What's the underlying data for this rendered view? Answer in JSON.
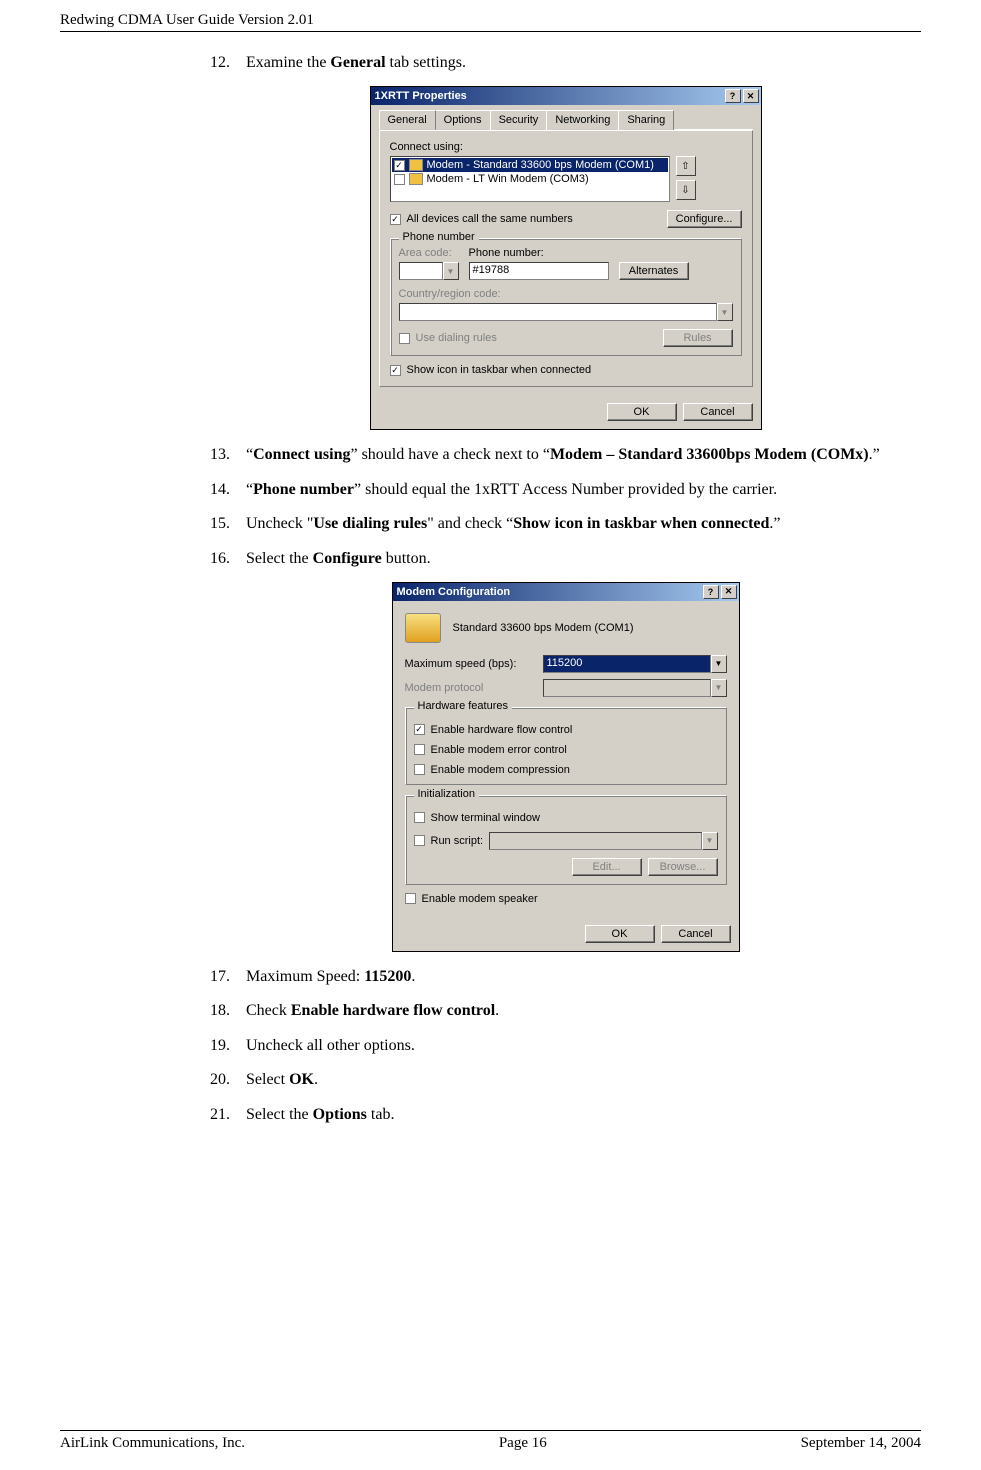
{
  "header": {
    "title": "Redwing CDMA User Guide Version 2.01"
  },
  "steps": {
    "s12": {
      "num": "12.",
      "pre": "Examine the ",
      "boldA": "General",
      "post": " tab settings."
    },
    "s13": {
      "num": "13.",
      "p1": "“",
      "b1": "Connect using",
      "p2": "” should have a check next to “",
      "b2": "Modem – Standard 33600bps Modem (COMx)",
      "p3": ".”"
    },
    "s14": {
      "num": "14.",
      "p1": "“",
      "b1": "Phone number",
      "p2": "” should equal the 1xRTT Access Number provided by the carrier."
    },
    "s15": {
      "num": "15.",
      "p1": "Uncheck \"",
      "b1": "Use dialing rules",
      "p2": "\" and check “",
      "b2": "Show icon in taskbar when connected",
      "p3": ".”"
    },
    "s16": {
      "num": "16.",
      "p1": "Select the ",
      "b1": "Configure",
      "p2": " button."
    },
    "s17": {
      "num": "17.",
      "p1": "Maximum Speed: ",
      "b1": "115200",
      "p2": "."
    },
    "s18": {
      "num": "18.",
      "p1": "Check ",
      "b1": "Enable hardware flow control",
      "p2": "."
    },
    "s19": {
      "num": "19.",
      "text": "Uncheck all other options."
    },
    "s20": {
      "num": "20.",
      "p1": "Select ",
      "b1": "OK",
      "p2": "."
    },
    "s21": {
      "num": "21.",
      "p1": "Select the ",
      "b1": "Options",
      "p2": " tab."
    }
  },
  "dialog1": {
    "title": "1XRTT Properties",
    "tabs": [
      "General",
      "Options",
      "Security",
      "Networking",
      "Sharing"
    ],
    "connect_using_label": "Connect using:",
    "modems": [
      {
        "checked": true,
        "label": "Modem - Standard 33600 bps Modem (COM1)",
        "selected": true
      },
      {
        "checked": false,
        "label": "Modem - LT Win Modem (COM3)",
        "selected": false
      }
    ],
    "all_devices": "All devices call the same numbers",
    "configure_btn": "Configure...",
    "phone_group": "Phone number",
    "area_code_label": "Area code:",
    "phone_number_label": "Phone number:",
    "phone_number_value": "#19788",
    "alternates_btn": "Alternates",
    "country_label": "Country/region code:",
    "use_dialing": "Use dialing rules",
    "rules_btn": "Rules",
    "show_icon": "Show icon in taskbar when connected",
    "ok": "OK",
    "cancel": "Cancel"
  },
  "dialog2": {
    "title": "Modem Configuration",
    "modem_name": "Standard 33600 bps Modem (COM1)",
    "max_speed_label": "Maximum speed (bps):",
    "max_speed_value": "115200",
    "modem_protocol_label": "Modem protocol",
    "hw_group": "Hardware features",
    "hw_flow": "Enable hardware flow control",
    "hw_error": "Enable modem error control",
    "hw_comp": "Enable modem compression",
    "init_group": "Initialization",
    "show_term": "Show terminal window",
    "run_script": "Run script:",
    "edit_btn": "Edit...",
    "browse_btn": "Browse...",
    "speaker": "Enable modem speaker",
    "ok": "OK",
    "cancel": "Cancel"
  },
  "footer": {
    "left": "AirLink Communications, Inc.",
    "center": "Page 16",
    "right": "September 14, 2004"
  }
}
